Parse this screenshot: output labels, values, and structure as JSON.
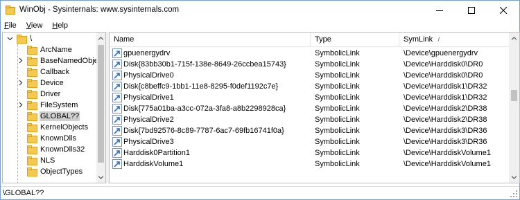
{
  "window": {
    "title": "WinObj - Sysinternals: www.sysinternals.com",
    "accent": "#1f5fbf"
  },
  "menu": {
    "items": [
      {
        "label": "File"
      },
      {
        "label": "View"
      },
      {
        "label": "Help"
      }
    ]
  },
  "tree": {
    "root_label": "\\",
    "items": [
      {
        "label": "ArcName",
        "expandable": false
      },
      {
        "label": "BaseNamedObjects",
        "expandable": true
      },
      {
        "label": "Callback",
        "expandable": false
      },
      {
        "label": "Device",
        "expandable": true
      },
      {
        "label": "Driver",
        "expandable": false
      },
      {
        "label": "FileSystem",
        "expandable": true
      },
      {
        "label": "GLOBAL??",
        "expandable": false,
        "selected": true
      },
      {
        "label": "KernelObjects",
        "expandable": false
      },
      {
        "label": "KnownDlls",
        "expandable": false
      },
      {
        "label": "KnownDlls32",
        "expandable": false
      },
      {
        "label": "NLS",
        "expandable": false
      },
      {
        "label": "ObjectTypes",
        "expandable": false
      }
    ]
  },
  "list": {
    "columns": [
      {
        "label": "Name"
      },
      {
        "label": "Type"
      },
      {
        "label": "SymLink"
      }
    ],
    "rows": [
      {
        "name": "gpuenergydrv",
        "type": "SymbolicLink",
        "symlink": "\\Device\\gpuenergydrv"
      },
      {
        "name": "Disk{83bb30b1-715f-138e-8649-26ccbea15743}",
        "type": "SymbolicLink",
        "symlink": "\\Device\\Harddisk0\\DR0"
      },
      {
        "name": "PhysicalDrive0",
        "type": "SymbolicLink",
        "symlink": "\\Device\\Harddisk0\\DR0"
      },
      {
        "name": "Disk{c8beffc9-1bb1-11e8-8295-f0def1192c7e}",
        "type": "SymbolicLink",
        "symlink": "\\Device\\Harddisk1\\DR32"
      },
      {
        "name": "PhysicalDrive1",
        "type": "SymbolicLink",
        "symlink": "\\Device\\Harddisk1\\DR32"
      },
      {
        "name": "Disk{775a01ba-a3cc-072a-3fa8-a8b2298928ca}",
        "type": "SymbolicLink",
        "symlink": "\\Device\\Harddisk2\\DR38"
      },
      {
        "name": "PhysicalDrive2",
        "type": "SymbolicLink",
        "symlink": "\\Device\\Harddisk2\\DR38"
      },
      {
        "name": "Disk{7bd92576-8c89-7787-6ac7-69fb16741f0a}",
        "type": "SymbolicLink",
        "symlink": "\\Device\\Harddisk3\\DR36"
      },
      {
        "name": "PhysicalDrive3",
        "type": "SymbolicLink",
        "symlink": "\\Device\\Harddisk3\\DR36"
      },
      {
        "name": "Harddisk0Partition1",
        "type": "SymbolicLink",
        "symlink": "\\Device\\HarddiskVolume1"
      },
      {
        "name": "HarddiskVolume1",
        "type": "SymbolicLink",
        "symlink": "\\Device\\HarddiskVolume1"
      }
    ]
  },
  "status": {
    "path": "\\GLOBAL??"
  },
  "icons": {
    "tree_folder": "folder-icon",
    "list_item": "symbolic-link-icon",
    "app": "winobj-app-icon"
  },
  "colors": {
    "folder": "#f5c94e",
    "folder_edge": "#d9a520",
    "selection": "#d0d0d0",
    "link_icon": "#2b6cc4"
  }
}
